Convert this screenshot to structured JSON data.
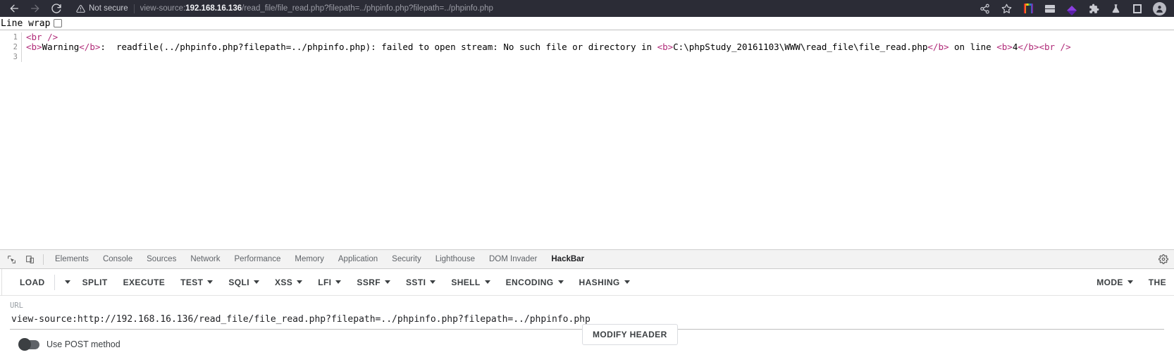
{
  "browser": {
    "nav": {
      "back_label": "Back",
      "forward_label": "Forward",
      "reload_label": "Reload"
    },
    "security": {
      "icon": "warning-triangle-icon",
      "label": "Not secure"
    },
    "address": {
      "scheme": "view-source:",
      "host": "192.168.16.136",
      "path": "/read_file/file_read.php?filepath=../phpinfo.php?filepath=../phpinfo.php",
      "full": "view-source:192.168.16.136/read_file/file_read.php?filepath=../phpinfo.php?filepath=../phpinfo.php"
    },
    "actions": [
      {
        "name": "share-icon",
        "glyph": "share"
      },
      {
        "name": "bookmark-star-icon",
        "glyph": "star"
      },
      {
        "name": "extension-rainbow-icon",
        "glyph": "rainbow"
      },
      {
        "name": "extension-gray-icon",
        "glyph": "gray"
      },
      {
        "name": "extension-diamond-icon",
        "glyph": "diamond"
      },
      {
        "name": "extensions-puzzle-icon",
        "glyph": "puzzle"
      },
      {
        "name": "extension-flask-icon",
        "glyph": "flask"
      },
      {
        "name": "extension-square-icon",
        "glyph": "square"
      },
      {
        "name": "profile-avatar-icon",
        "glyph": "avatar"
      }
    ]
  },
  "viewsource": {
    "line_wrap_label": "Line wrap",
    "line_wrap_checked": false,
    "line_numbers": [
      "1",
      "2",
      "3"
    ],
    "lines": [
      {
        "parts": [
          {
            "t": "tag",
            "v": "<br />"
          }
        ]
      },
      {
        "parts": [
          {
            "t": "tag",
            "v": "<b>"
          },
          {
            "t": "text",
            "v": "Warning"
          },
          {
            "t": "tag",
            "v": "</b>"
          },
          {
            "t": "text",
            "v": ":  readfile(../phpinfo.php?filepath=../phpinfo.php): failed to open stream: No such file or directory in "
          },
          {
            "t": "tag",
            "v": "<b>"
          },
          {
            "t": "text",
            "v": "C:\\phpStudy_20161103\\WWW\\read_file\\file_read.php"
          },
          {
            "t": "tag",
            "v": "</b>"
          },
          {
            "t": "text",
            "v": " on line "
          },
          {
            "t": "tag",
            "v": "<b>"
          },
          {
            "t": "text",
            "v": "4"
          },
          {
            "t": "tag",
            "v": "</b>"
          },
          {
            "t": "tag",
            "v": "<br />"
          }
        ]
      },
      {
        "parts": []
      }
    ]
  },
  "devtools": {
    "left_icons": [
      {
        "name": "inspect-element-icon"
      },
      {
        "name": "device-toolbar-icon"
      }
    ],
    "tabs": [
      {
        "label": "Elements",
        "active": false
      },
      {
        "label": "Console",
        "active": false
      },
      {
        "label": "Sources",
        "active": false
      },
      {
        "label": "Network",
        "active": false
      },
      {
        "label": "Performance",
        "active": false
      },
      {
        "label": "Memory",
        "active": false
      },
      {
        "label": "Application",
        "active": false
      },
      {
        "label": "Security",
        "active": false
      },
      {
        "label": "Lighthouse",
        "active": false
      },
      {
        "label": "DOM Invader",
        "active": false
      },
      {
        "label": "HackBar",
        "active": true
      }
    ],
    "settings_icon": "gear-icon"
  },
  "hackbar": {
    "buttons": [
      {
        "label": "LOAD",
        "caret": false,
        "split_caret": true
      },
      {
        "label": "SPLIT",
        "caret": false,
        "split_caret": false
      },
      {
        "label": "EXECUTE",
        "caret": false,
        "split_caret": false
      },
      {
        "label": "TEST",
        "caret": true,
        "split_caret": false
      },
      {
        "label": "SQLI",
        "caret": true,
        "split_caret": false
      },
      {
        "label": "XSS",
        "caret": true,
        "split_caret": false
      },
      {
        "label": "LFI",
        "caret": true,
        "split_caret": false
      },
      {
        "label": "SSRF",
        "caret": true,
        "split_caret": false
      },
      {
        "label": "SSTI",
        "caret": true,
        "split_caret": false
      },
      {
        "label": "SHELL",
        "caret": true,
        "split_caret": false
      },
      {
        "label": "ENCODING",
        "caret": true,
        "split_caret": false
      },
      {
        "label": "HASHING",
        "caret": true,
        "split_caret": false
      }
    ],
    "right_buttons": [
      {
        "label": "MODE",
        "caret": true
      },
      {
        "label": "THE",
        "caret": false
      }
    ],
    "url_field": {
      "label": "URL",
      "value": "view-source:http://192.168.16.136/read_file/file_read.php?filepath=../phpinfo.php?filepath=../phpinfo.php",
      "placeholder": "URL"
    },
    "post_toggle": {
      "label": "Use POST method",
      "enabled": false
    },
    "modify_header_label": "MODIFY HEADER"
  }
}
